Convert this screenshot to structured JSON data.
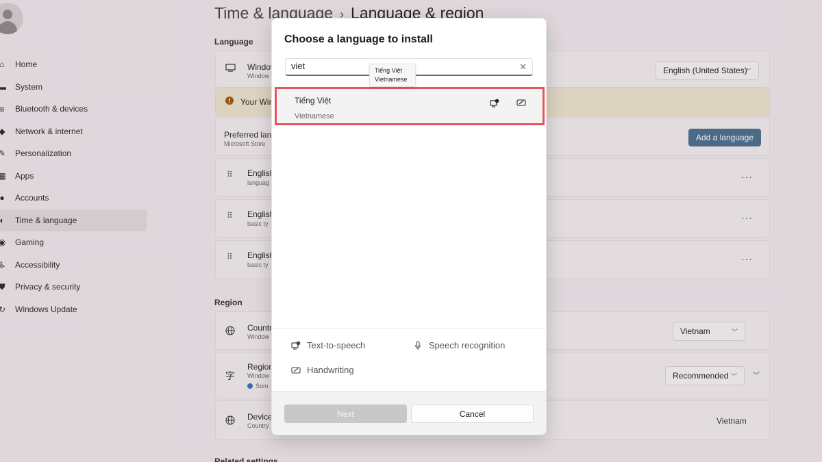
{
  "background": {
    "breadcrumb": {
      "parent": "Time & language",
      "separator": "›",
      "current": "Language & region"
    },
    "nav": [
      {
        "label": "Home",
        "icon": "home-icon",
        "glyph": "⌂"
      },
      {
        "label": "System",
        "icon": "system-icon",
        "glyph": "▬"
      },
      {
        "label": "Bluetooth & devices",
        "icon": "bluetooth-icon",
        "glyph": "ʙ"
      },
      {
        "label": "Network & internet",
        "icon": "wifi-icon",
        "glyph": "◆"
      },
      {
        "label": "Personalization",
        "icon": "brush-icon",
        "glyph": "✎"
      },
      {
        "label": "Apps",
        "icon": "apps-icon",
        "glyph": "▦"
      },
      {
        "label": "Accounts",
        "icon": "accounts-icon",
        "glyph": "●"
      },
      {
        "label": "Time & language",
        "icon": "globe-clock-icon",
        "glyph": "◐"
      },
      {
        "label": "Gaming",
        "icon": "gamepad-icon",
        "glyph": "◉"
      },
      {
        "label": "Accessibility",
        "icon": "accessibility-icon",
        "glyph": "♿"
      },
      {
        "label": "Privacy & security",
        "icon": "shield-icon",
        "glyph": "⛊"
      },
      {
        "label": "Windows Update",
        "icon": "update-icon",
        "glyph": "↻"
      }
    ],
    "language_section": "Language",
    "display_lang": {
      "title": "Windov",
      "sub": "Window",
      "value": "English (United States)"
    },
    "warning": {
      "text": "Your Win"
    },
    "preferred": {
      "title": "Preferred lang",
      "sub": "Microsoft Store",
      "button": "Add a language"
    },
    "lang_rows": [
      {
        "title": "English",
        "sub": "languag"
      },
      {
        "title": "English",
        "sub": "basic ty"
      },
      {
        "title": "English",
        "sub": "basic ty"
      }
    ],
    "more_glyph": "···",
    "region_section": "Region",
    "country": {
      "title": "Countr",
      "sub": "Window",
      "value": "Vietnam"
    },
    "regional_format": {
      "title": "Region",
      "sub": "Window",
      "note": "Som",
      "value": "Recommended"
    },
    "device": {
      "title": "Device",
      "sub": "Country",
      "value": "Vietnam"
    },
    "related": "Related settings"
  },
  "dialog": {
    "title": "Choose a language to install",
    "search": {
      "value": "viet",
      "clear_glyph": "✕"
    },
    "tooltip": {
      "line1": "Tiếng Việt",
      "line2": "Vietnamese"
    },
    "result": {
      "native": "Tiếng Việt",
      "english": "Vietnamese"
    },
    "features": {
      "tts": "Text-to-speech",
      "speech": "Speech recognition",
      "handwriting": "Handwriting"
    },
    "buttons": {
      "next": "Next",
      "cancel": "Cancel"
    }
  },
  "colors": {
    "accent": "#4a6f8e",
    "highlight": "#e8525b",
    "warning_bg": "#ece4cf"
  }
}
